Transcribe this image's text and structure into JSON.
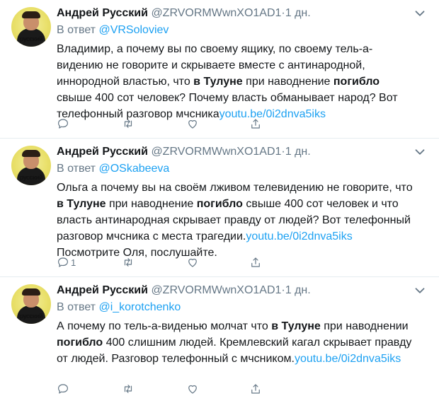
{
  "tweets": [
    {
      "author": "Андрей Русский",
      "handle": "@ZRVORMWwnXO1AD1",
      "dot": "·",
      "time": "1 дн.",
      "reply_prefix": "В ответ ",
      "reply_to": "@VRSoloviev",
      "avatar_caption": "русский",
      "text": {
        "p1": "Владимир, а почему вы по своему ящику, по своему тель-а-видению не говорите и скрываете вместе с антинародной, иннородной властью, что ",
        "b1": "в Тулуне",
        "p2": " при наводнение ",
        "b2": "погибло",
        "p3": " свыше 400 сот человек? Почему власть обманывает народ? Вот телефонный разговор мчсника",
        "link": "youtu.be/0i2dnva5iks",
        "p4": ""
      },
      "reply_count": ""
    },
    {
      "author": "Андрей Русский",
      "handle": "@ZRVORMWwnXO1AD1",
      "dot": "·",
      "time": "1 дн.",
      "reply_prefix": "В ответ ",
      "reply_to": "@OSkabeeva",
      "avatar_caption": "русский",
      "text": {
        "p1": "Ольга а почему вы на своём лживом телевидению не говорите, что ",
        "b1": "в Тулуне",
        "p2": " при наводнение ",
        "b2": "погибло",
        "p3": " свыше 400 сот человек и что власть антинародная скрывает правду от людей? Вот телефонный разговор мчсника с места трагедии.",
        "link": "youtu.be/0i2dnva5iks",
        "p4": " Посмотрите Оля, послушайте."
      },
      "reply_count": "1"
    },
    {
      "author": "Андрей Русский",
      "handle": "@ZRVORMWwnXO1AD1",
      "dot": "·",
      "time": "1 дн.",
      "reply_prefix": "В ответ ",
      "reply_to": "@i_korotchenko",
      "avatar_caption": "русский",
      "text": {
        "p1": "А почему по тель-а-виденью молчат что ",
        "b1": "в Тулуне",
        "p2": " при наводнении ",
        "b2": "погибло",
        "p3": " 400 слишним людей. Кремлевский кагал скрывает правду от людей. Разговор телефонный с мчсником.",
        "link": "youtu.be/0i2dnva5iks",
        "p4": ""
      },
      "reply_count": ""
    }
  ],
  "icons": [
    "reply-icon",
    "retweet-icon",
    "like-icon",
    "share-icon",
    "chevron-down-icon"
  ],
  "colors": {
    "link": "#1da1f2",
    "secondary": "#657786",
    "divider": "#e6ecf0",
    "text": "#14171a"
  }
}
